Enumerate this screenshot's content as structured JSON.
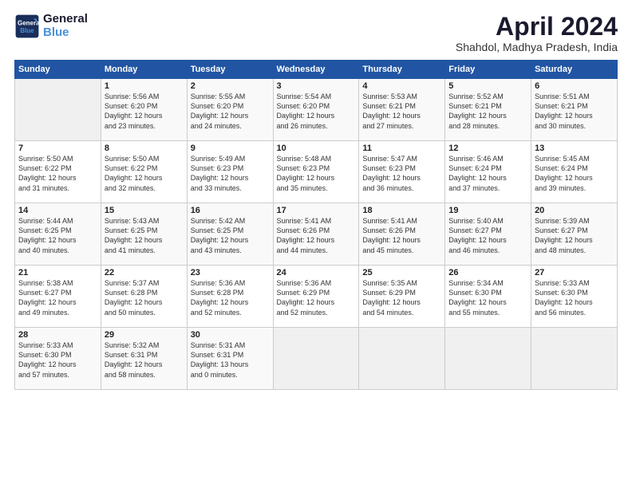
{
  "header": {
    "logo_line1": "General",
    "logo_line2": "Blue",
    "month": "April 2024",
    "location": "Shahdol, Madhya Pradesh, India"
  },
  "weekdays": [
    "Sunday",
    "Monday",
    "Tuesday",
    "Wednesday",
    "Thursday",
    "Friday",
    "Saturday"
  ],
  "weeks": [
    [
      {
        "day": "",
        "content": ""
      },
      {
        "day": "1",
        "content": "Sunrise: 5:56 AM\nSunset: 6:20 PM\nDaylight: 12 hours\nand 23 minutes."
      },
      {
        "day": "2",
        "content": "Sunrise: 5:55 AM\nSunset: 6:20 PM\nDaylight: 12 hours\nand 24 minutes."
      },
      {
        "day": "3",
        "content": "Sunrise: 5:54 AM\nSunset: 6:20 PM\nDaylight: 12 hours\nand 26 minutes."
      },
      {
        "day": "4",
        "content": "Sunrise: 5:53 AM\nSunset: 6:21 PM\nDaylight: 12 hours\nand 27 minutes."
      },
      {
        "day": "5",
        "content": "Sunrise: 5:52 AM\nSunset: 6:21 PM\nDaylight: 12 hours\nand 28 minutes."
      },
      {
        "day": "6",
        "content": "Sunrise: 5:51 AM\nSunset: 6:21 PM\nDaylight: 12 hours\nand 30 minutes."
      }
    ],
    [
      {
        "day": "7",
        "content": "Sunrise: 5:50 AM\nSunset: 6:22 PM\nDaylight: 12 hours\nand 31 minutes."
      },
      {
        "day": "8",
        "content": "Sunrise: 5:50 AM\nSunset: 6:22 PM\nDaylight: 12 hours\nand 32 minutes."
      },
      {
        "day": "9",
        "content": "Sunrise: 5:49 AM\nSunset: 6:23 PM\nDaylight: 12 hours\nand 33 minutes."
      },
      {
        "day": "10",
        "content": "Sunrise: 5:48 AM\nSunset: 6:23 PM\nDaylight: 12 hours\nand 35 minutes."
      },
      {
        "day": "11",
        "content": "Sunrise: 5:47 AM\nSunset: 6:23 PM\nDaylight: 12 hours\nand 36 minutes."
      },
      {
        "day": "12",
        "content": "Sunrise: 5:46 AM\nSunset: 6:24 PM\nDaylight: 12 hours\nand 37 minutes."
      },
      {
        "day": "13",
        "content": "Sunrise: 5:45 AM\nSunset: 6:24 PM\nDaylight: 12 hours\nand 39 minutes."
      }
    ],
    [
      {
        "day": "14",
        "content": "Sunrise: 5:44 AM\nSunset: 6:25 PM\nDaylight: 12 hours\nand 40 minutes."
      },
      {
        "day": "15",
        "content": "Sunrise: 5:43 AM\nSunset: 6:25 PM\nDaylight: 12 hours\nand 41 minutes."
      },
      {
        "day": "16",
        "content": "Sunrise: 5:42 AM\nSunset: 6:25 PM\nDaylight: 12 hours\nand 43 minutes."
      },
      {
        "day": "17",
        "content": "Sunrise: 5:41 AM\nSunset: 6:26 PM\nDaylight: 12 hours\nand 44 minutes."
      },
      {
        "day": "18",
        "content": "Sunrise: 5:41 AM\nSunset: 6:26 PM\nDaylight: 12 hours\nand 45 minutes."
      },
      {
        "day": "19",
        "content": "Sunrise: 5:40 AM\nSunset: 6:27 PM\nDaylight: 12 hours\nand 46 minutes."
      },
      {
        "day": "20",
        "content": "Sunrise: 5:39 AM\nSunset: 6:27 PM\nDaylight: 12 hours\nand 48 minutes."
      }
    ],
    [
      {
        "day": "21",
        "content": "Sunrise: 5:38 AM\nSunset: 6:27 PM\nDaylight: 12 hours\nand 49 minutes."
      },
      {
        "day": "22",
        "content": "Sunrise: 5:37 AM\nSunset: 6:28 PM\nDaylight: 12 hours\nand 50 minutes."
      },
      {
        "day": "23",
        "content": "Sunrise: 5:36 AM\nSunset: 6:28 PM\nDaylight: 12 hours\nand 52 minutes."
      },
      {
        "day": "24",
        "content": "Sunrise: 5:36 AM\nSunset: 6:29 PM\nDaylight: 12 hours\nand 52 minutes."
      },
      {
        "day": "25",
        "content": "Sunrise: 5:35 AM\nSunset: 6:29 PM\nDaylight: 12 hours\nand 54 minutes."
      },
      {
        "day": "26",
        "content": "Sunrise: 5:34 AM\nSunset: 6:30 PM\nDaylight: 12 hours\nand 55 minutes."
      },
      {
        "day": "27",
        "content": "Sunrise: 5:33 AM\nSunset: 6:30 PM\nDaylight: 12 hours\nand 56 minutes."
      }
    ],
    [
      {
        "day": "28",
        "content": "Sunrise: 5:33 AM\nSunset: 6:30 PM\nDaylight: 12 hours\nand 57 minutes."
      },
      {
        "day": "29",
        "content": "Sunrise: 5:32 AM\nSunset: 6:31 PM\nDaylight: 12 hours\nand 58 minutes."
      },
      {
        "day": "30",
        "content": "Sunrise: 5:31 AM\nSunset: 6:31 PM\nDaylight: 13 hours\nand 0 minutes."
      },
      {
        "day": "",
        "content": ""
      },
      {
        "day": "",
        "content": ""
      },
      {
        "day": "",
        "content": ""
      },
      {
        "day": "",
        "content": ""
      }
    ]
  ]
}
